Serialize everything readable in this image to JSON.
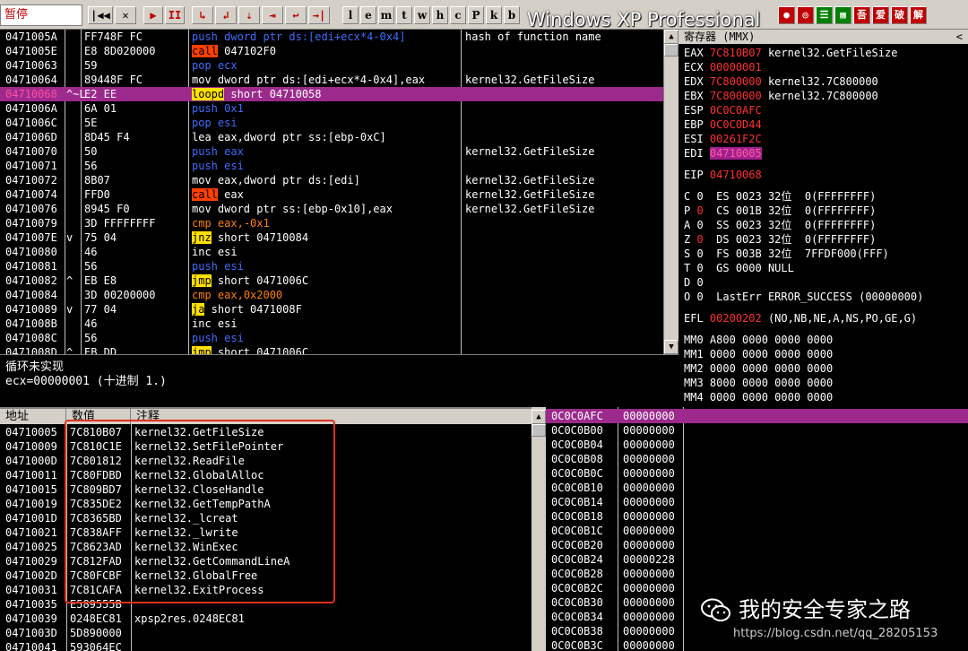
{
  "toolbar": {
    "pause_label": "暂停",
    "buttons": [
      "|◀◀",
      "✕",
      "▶",
      "II",
      "↳",
      "↲",
      "⇣",
      "⇥",
      "↩",
      "→|"
    ],
    "letters": [
      "l",
      "e",
      "m",
      "t",
      "w",
      "h",
      "c",
      "P",
      "k",
      "b"
    ],
    "right_buttons": [
      "●",
      "◎",
      "☰",
      "▦",
      "吾",
      "爱",
      "破",
      "解"
    ],
    "window_caption": "Windows XP Professional"
  },
  "disasm": [
    {
      "addr": "0471005A",
      "mark": "",
      "hex": "FF748F FC",
      "ins": [
        [
          "push",
          "b"
        ],
        [
          " dword ptr ds:[edi+ecx*4-0x4]",
          "b"
        ]
      ],
      "cmt": "hash of function name"
    },
    {
      "addr": "0471005E",
      "mark": "",
      "hex": "E8 8D020000",
      "ins": [
        [
          "call",
          "r"
        ],
        [
          " 047102F0",
          "w"
        ]
      ],
      "cmt": ""
    },
    {
      "addr": "04710063",
      "mark": "",
      "hex": "59",
      "ins": [
        [
          "pop",
          "b"
        ],
        [
          " ecx",
          "b"
        ]
      ],
      "cmt": ""
    },
    {
      "addr": "04710064",
      "mark": "",
      "hex": "89448F FC",
      "ins": [
        [
          "mov",
          "w"
        ],
        [
          " dword ptr ds:[edi+ecx*4-0x4],eax",
          "w"
        ]
      ],
      "cmt": "kernel32.GetFileSize"
    },
    {
      "addr": "04710068",
      "mark": "^~L",
      "hex": "E2 EE",
      "ins": [
        [
          "loopd",
          "y"
        ],
        [
          " short 04710058",
          "w"
        ]
      ],
      "cmt": "",
      "cur": true
    },
    {
      "addr": "0471006A",
      "mark": "",
      "hex": "6A 01",
      "ins": [
        [
          "push",
          "b"
        ],
        [
          " 0x1",
          "b"
        ]
      ],
      "cmt": ""
    },
    {
      "addr": "0471006C",
      "mark": "",
      "hex": "5E",
      "ins": [
        [
          "pop",
          "b"
        ],
        [
          " esi",
          "b"
        ]
      ],
      "cmt": ""
    },
    {
      "addr": "0471006D",
      "mark": "",
      "hex": "8D45 F4",
      "ins": [
        [
          "lea",
          "w"
        ],
        [
          " eax,dword ptr ss:[ebp-0xC]",
          "w"
        ]
      ],
      "cmt": ""
    },
    {
      "addr": "04710070",
      "mark": "",
      "hex": "50",
      "ins": [
        [
          "push",
          "b"
        ],
        [
          " eax",
          "b"
        ]
      ],
      "cmt": "kernel32.GetFileSize"
    },
    {
      "addr": "04710071",
      "mark": "",
      "hex": "56",
      "ins": [
        [
          "push",
          "b"
        ],
        [
          " esi",
          "b"
        ]
      ],
      "cmt": ""
    },
    {
      "addr": "04710072",
      "mark": "",
      "hex": "8B07",
      "ins": [
        [
          "mov",
          "w"
        ],
        [
          " eax,dword ptr ds:[edi]",
          "w"
        ]
      ],
      "cmt": "kernel32.GetFileSize"
    },
    {
      "addr": "04710074",
      "mark": "",
      "hex": "FFD0",
      "ins": [
        [
          "call",
          "r"
        ],
        [
          " eax",
          "w"
        ]
      ],
      "cmt": "kernel32.GetFileSize"
    },
    {
      "addr": "04710076",
      "mark": "",
      "hex": "8945 F0",
      "ins": [
        [
          "mov",
          "w"
        ],
        [
          " dword ptr ss:[ebp-0x10],eax",
          "w"
        ]
      ],
      "cmt": "kernel32.GetFileSize"
    },
    {
      "addr": "04710079",
      "mark": "",
      "hex": "3D FFFFFFFF",
      "ins": [
        [
          "cmp",
          "o"
        ],
        [
          " eax,",
          "o"
        ],
        [
          "-0x1",
          "o"
        ]
      ],
      "cmt": ""
    },
    {
      "addr": "0471007E",
      "mark": "v",
      "hex": "75 04",
      "ins": [
        [
          "jnz",
          "y"
        ],
        [
          " short 04710084",
          "w"
        ]
      ],
      "cmt": ""
    },
    {
      "addr": "04710080",
      "mark": "",
      "hex": "46",
      "ins": [
        [
          "inc",
          "w"
        ],
        [
          " esi",
          "w"
        ]
      ],
      "cmt": ""
    },
    {
      "addr": "04710081",
      "mark": "",
      "hex": "56",
      "ins": [
        [
          "push",
          "b"
        ],
        [
          " esi",
          "b"
        ]
      ],
      "cmt": ""
    },
    {
      "addr": "04710082",
      "mark": "^",
      "hex": "EB E8",
      "ins": [
        [
          "jmp",
          "y"
        ],
        [
          " short 0471006C",
          "w"
        ]
      ],
      "cmt": ""
    },
    {
      "addr": "04710084",
      "mark": "",
      "hex": "3D 00200000",
      "ins": [
        [
          "cmp",
          "o"
        ],
        [
          " eax,",
          "o"
        ],
        [
          "0x2000",
          "o"
        ]
      ],
      "cmt": ""
    },
    {
      "addr": "04710089",
      "mark": "v",
      "hex": "77 04",
      "ins": [
        [
          "ja",
          "y"
        ],
        [
          " short 0471008F",
          "w"
        ]
      ],
      "cmt": ""
    },
    {
      "addr": "0471008B",
      "mark": "",
      "hex": "46",
      "ins": [
        [
          "inc",
          "w"
        ],
        [
          " esi",
          "w"
        ]
      ],
      "cmt": ""
    },
    {
      "addr": "0471008C",
      "mark": "",
      "hex": "56",
      "ins": [
        [
          "push",
          "b"
        ],
        [
          " esi",
          "b"
        ]
      ],
      "cmt": ""
    },
    {
      "addr": "0471008D",
      "mark": "^",
      "hex": "EB DD",
      "ins": [
        [
          "jmp",
          "y"
        ],
        [
          " short 0471006C",
          "w"
        ]
      ],
      "cmt": ""
    }
  ],
  "info": {
    "line1": "循环未实现",
    "line2": "ecx=00000001 (十进制 1.)"
  },
  "registers": {
    "title": "寄存器 (MMX)",
    "collapse": "<",
    "gp": [
      {
        "name": "EAX",
        "val": "7C810B07",
        "note": "kernel32.GetFileSize"
      },
      {
        "name": "ECX",
        "val": "00000001",
        "note": ""
      },
      {
        "name": "EDX",
        "val": "7C800000",
        "note": "kernel32.7C800000"
      },
      {
        "name": "EBX",
        "val": "7C800000",
        "note": "kernel32.7C800000"
      },
      {
        "name": "ESP",
        "val": "0C0C0AFC",
        "note": ""
      },
      {
        "name": "EBP",
        "val": "0C0C0D44",
        "note": ""
      },
      {
        "name": "ESI",
        "val": "00261F2C",
        "note": ""
      },
      {
        "name": "EDI",
        "val": "04710005",
        "note": "",
        "hl": true
      }
    ],
    "eip": {
      "name": "EIP",
      "val": "04710068"
    },
    "flags": [
      {
        "f": "C",
        "v": "0",
        "seg": "ES 0023 32位  0(FFFFFFFF)"
      },
      {
        "f": "P",
        "v": "0",
        "seg": "CS 001B 32位  0(FFFFFFFF)"
      },
      {
        "f": "A",
        "v": "0",
        "seg": "SS 0023 32位  0(FFFFFFFF)"
      },
      {
        "f": "Z",
        "v": "0",
        "seg": "DS 0023 32位  0(FFFFFFFF)"
      },
      {
        "f": "S",
        "v": "0",
        "seg": "FS 003B 32位  7FFDF000(FFF)"
      },
      {
        "f": "T",
        "v": "0",
        "seg": "GS 0000 NULL"
      },
      {
        "f": "D",
        "v": "0",
        "seg": ""
      },
      {
        "f": "O",
        "v": "0",
        "seg": "LastErr ERROR_SUCCESS (00000000)"
      }
    ],
    "flag_red": [
      "P",
      "Z"
    ],
    "efl": {
      "name": "EFL",
      "val": "00200202",
      "note": "(NO,NB,NE,A,NS,PO,GE,G)"
    },
    "mmx": [
      "MM0 A800 0000 0000 0000",
      "MM1 0000 0000 0000 0000",
      "MM2 0000 0000 0000 0000",
      "MM3 8000 0000 0000 0000",
      "MM4 0000 0000 0000 0000"
    ]
  },
  "dump": {
    "headers": [
      "地址",
      "数值",
      "注释"
    ],
    "rows": [
      {
        "a": "04710005",
        "v": "7C810B07",
        "c": "kernel32.GetFileSize"
      },
      {
        "a": "04710009",
        "v": "7C810C1E",
        "c": "kernel32.SetFilePointer"
      },
      {
        "a": "0471000D",
        "v": "7C801812",
        "c": "kernel32.ReadFile"
      },
      {
        "a": "04710011",
        "v": "7C80FDBD",
        "c": "kernel32.GlobalAlloc"
      },
      {
        "a": "04710015",
        "v": "7C809BD7",
        "c": "kernel32.CloseHandle"
      },
      {
        "a": "04710019",
        "v": "7C835DE2",
        "c": "kernel32.GetTempPathA"
      },
      {
        "a": "0471001D",
        "v": "7C8365BD",
        "c": "kernel32._lcreat"
      },
      {
        "a": "04710021",
        "v": "7C838AFF",
        "c": "kernel32._lwrite"
      },
      {
        "a": "04710025",
        "v": "7C8623AD",
        "c": "kernel32.WinExec"
      },
      {
        "a": "04710029",
        "v": "7C812FAD",
        "c": "kernel32.GetCommandLineA"
      },
      {
        "a": "0471002D",
        "v": "7C80FCBF",
        "c": "kernel32.GlobalFree"
      },
      {
        "a": "04710031",
        "v": "7C81CAFA",
        "c": "kernel32.ExitProcess"
      },
      {
        "a": "04710035",
        "v": "E589555B",
        "c": ""
      },
      {
        "a": "04710039",
        "v": "0248EC81",
        "c": "xpsp2res.0248EC81"
      },
      {
        "a": "0471003D",
        "v": "5D890000",
        "c": ""
      },
      {
        "a": "04710041",
        "v": "593064EC",
        "c": ""
      }
    ]
  },
  "stack": {
    "rows": [
      {
        "a": "0C0C0AFC",
        "v": "00000000",
        "cur": true
      },
      {
        "a": "0C0C0B00",
        "v": "00000000"
      },
      {
        "a": "0C0C0B04",
        "v": "00000000"
      },
      {
        "a": "0C0C0B08",
        "v": "00000000"
      },
      {
        "a": "0C0C0B0C",
        "v": "00000000"
      },
      {
        "a": "0C0C0B10",
        "v": "00000000"
      },
      {
        "a": "0C0C0B14",
        "v": "00000000"
      },
      {
        "a": "0C0C0B18",
        "v": "00000000"
      },
      {
        "a": "0C0C0B1C",
        "v": "00000000"
      },
      {
        "a": "0C0C0B20",
        "v": "00000000"
      },
      {
        "a": "0C0C0B24",
        "v": "00000228"
      },
      {
        "a": "0C0C0B28",
        "v": "00000000"
      },
      {
        "a": "0C0C0B2C",
        "v": "00000000"
      },
      {
        "a": "0C0C0B30",
        "v": "00000000"
      },
      {
        "a": "0C0C0B34",
        "v": "00000000"
      },
      {
        "a": "0C0C0B38",
        "v": "00000000"
      },
      {
        "a": "0C0C0B3C",
        "v": "00000000"
      }
    ]
  },
  "watermark": {
    "title": "我的安全专家之路",
    "url": "https://blog.csdn.net/qq_28205153"
  }
}
